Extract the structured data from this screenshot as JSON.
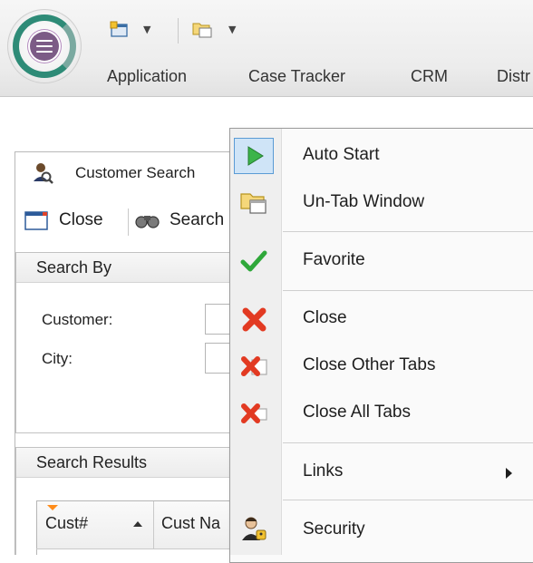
{
  "ribbon": {
    "tabs": [
      "Application",
      "Case Tracker",
      "CRM",
      "Distr"
    ]
  },
  "workspace": {
    "tab_label": "Customer Search",
    "toolbar": {
      "close_label": "Close",
      "search_label": "Search"
    },
    "search_by": {
      "title": "Search By",
      "customer_label": "Customer:",
      "city_label": "City:"
    },
    "search_results": {
      "title": "Search Results",
      "columns": [
        "Cust#",
        "Cust Na"
      ]
    }
  },
  "context_menu": {
    "items": [
      {
        "label": "Auto Start",
        "icon": "play-icon",
        "selected": true
      },
      {
        "label": "Un-Tab Window",
        "icon": "folder-window-icon"
      },
      {
        "label": "Favorite",
        "icon": "checkmark-icon"
      },
      {
        "label": "Close",
        "icon": "red-x-icon"
      },
      {
        "label": "Close Other Tabs",
        "icon": "close-other-tabs-icon"
      },
      {
        "label": "Close All Tabs",
        "icon": "close-all-tabs-icon"
      },
      {
        "label": "Links",
        "icon": "none",
        "has_submenu": true
      },
      {
        "label": "Security",
        "icon": "security-person-icon"
      }
    ]
  },
  "colors": {
    "accent_green": "#2e8b77",
    "play_green": "#3cb44a",
    "check_green": "#2fa83a",
    "close_red": "#e23a22",
    "menu_highlight": "#cfe4f7",
    "filter_orange": "#ff8c1a"
  }
}
